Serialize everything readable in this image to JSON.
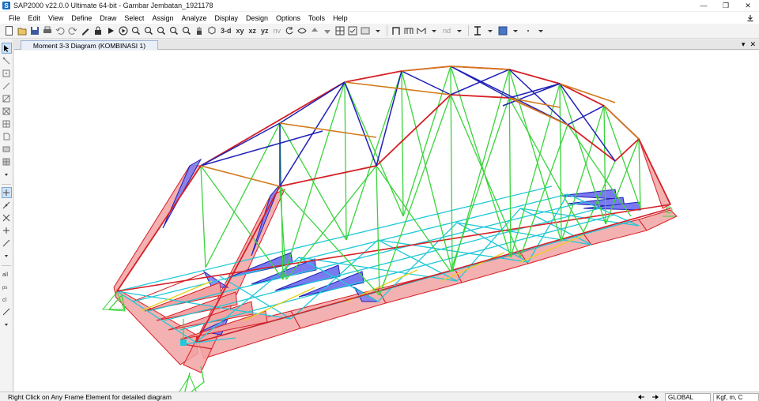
{
  "window": {
    "title": "SAP2000 v22.0.0 Ultimate 64-bit - Gambar Jembatan_1921178",
    "app_icon": "S",
    "minimize": "—",
    "restore": "❐",
    "close": "✕"
  },
  "menu": [
    "File",
    "Edit",
    "View",
    "Define",
    "Draw",
    "Select",
    "Assign",
    "Analyze",
    "Display",
    "Design",
    "Options",
    "Tools",
    "Help"
  ],
  "toolbar": {
    "view_3d": "3-d",
    "view_xy": "xy",
    "view_xz": "xz",
    "view_yz": "yz",
    "view_nv": "nv",
    "nd_label": "nd"
  },
  "tab": {
    "label": "Moment 3-3 Diagram  (KOMBINASI 1)",
    "ctrl_pin": "▾",
    "ctrl_close": "✕"
  },
  "status": {
    "message": "Right Click on Any Frame Element for detailed diagram",
    "coord_system": "GLOBAL",
    "units": "Kgf, m, C"
  },
  "colors": {
    "axial_red": "#d61f26",
    "chord_blue": "#2020b8",
    "vertical_green": "#39d43a",
    "deck_cyan": "#20c8d8",
    "floorbeam_orange": "#d27a1a",
    "moment_fill_red": "#f2a3a3",
    "moment_fill_blue": "#7a7af0"
  },
  "icons": {
    "pointer": "pointer-icon",
    "new": "new-file-icon",
    "open": "open-file-icon",
    "save": "save-icon",
    "print": "print-icon",
    "undo": "undo-icon",
    "redo": "redo-icon",
    "lock": "lock-icon",
    "run": "run-analysis-icon",
    "zoom": "zoom-icon",
    "pan": "pan-icon"
  }
}
